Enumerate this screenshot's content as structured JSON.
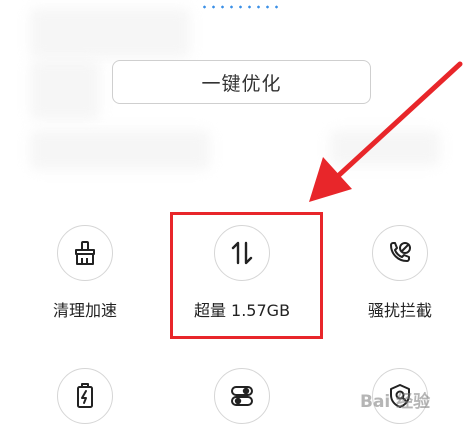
{
  "actions": {
    "optimize_label": "一键优化"
  },
  "tiles": [
    {
      "label": "清理加速",
      "icon": "broom-icon"
    },
    {
      "label": "超量 1.57GB",
      "icon": "data-transfer-icon"
    },
    {
      "label": "骚扰拦截",
      "icon": "phone-block-icon"
    },
    {
      "label": "",
      "icon": "battery-icon"
    },
    {
      "label": "",
      "icon": "apps-toggle-icon"
    },
    {
      "label": "",
      "icon": "shield-search-icon"
    }
  ],
  "annotation": {
    "highlight_color": "#e8262a"
  },
  "watermark": {
    "text": "Bai 经验"
  }
}
